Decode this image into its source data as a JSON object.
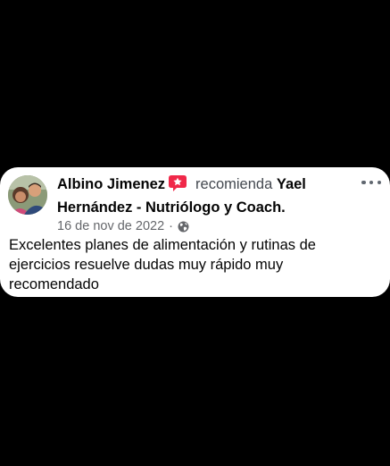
{
  "review": {
    "author": "Albino Jimenez",
    "verb": "recomienda",
    "page_name": "Yael Hernández - Nutriólogo y Coach.",
    "date": "16 de nov de 2022",
    "separator": "·",
    "text": "Excelentes planes de alimentación y rutinas de ejercicios resuelve dudas muy rápido muy recomendado",
    "privacy_icon": "globe-icon",
    "recommend_icon": "recommend-badge-icon",
    "more_icon": "more-options-icon"
  },
  "colors": {
    "background": "#000000",
    "card": "#ffffff",
    "badge": "#f02849",
    "secondary_text": "#65676b"
  }
}
